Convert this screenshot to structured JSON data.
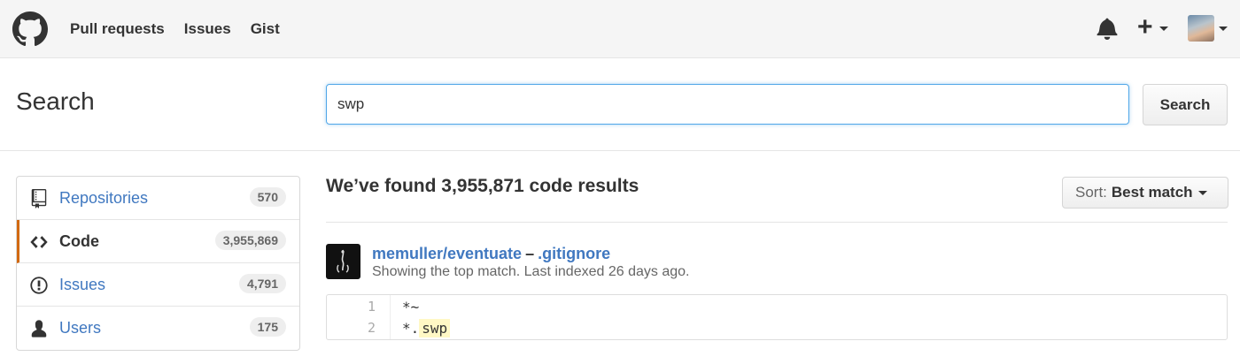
{
  "header": {
    "nav": [
      "Pull requests",
      "Issues",
      "Gist"
    ],
    "icons": {
      "logo": "github-octocat-icon",
      "notifications": "bell-icon",
      "create": "plus-icon",
      "user": "avatar"
    }
  },
  "search": {
    "title": "Search",
    "query": "swp",
    "button_label": "Search"
  },
  "sidebar": {
    "items": [
      {
        "label": "Repositories",
        "count": "570",
        "icon": "repo-icon",
        "selected": false
      },
      {
        "label": "Code",
        "count": "3,955,869",
        "icon": "code-icon",
        "selected": true
      },
      {
        "label": "Issues",
        "count": "4,791",
        "icon": "issue-icon",
        "selected": false
      },
      {
        "label": "Users",
        "count": "175",
        "icon": "person-icon",
        "selected": false
      }
    ]
  },
  "results": {
    "summary": "We’ve found 3,955,871 code results",
    "sort": {
      "prefix": "Sort:",
      "value": "Best match"
    },
    "items": [
      {
        "repo": "memuller/eventuate",
        "separator": "–",
        "file": ".gitignore",
        "meta": "Showing the top match. Last indexed 26 days ago.",
        "lines": [
          {
            "number": "1",
            "text": "*~",
            "prefix": "*~",
            "highlight": ""
          },
          {
            "number": "2",
            "text": "*.swp",
            "prefix": "*.",
            "highlight": "swp"
          }
        ]
      }
    ]
  },
  "colors": {
    "link": "#4078c0",
    "selected_accent": "#d26911",
    "focus_border": "#51a7e8",
    "highlight": "#fff8c5"
  }
}
